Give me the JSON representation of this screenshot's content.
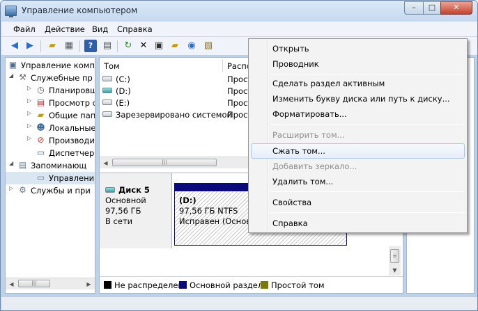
{
  "window": {
    "title": "Управление компьютером",
    "min_label": "–",
    "max_label": "□",
    "close_label": "✕"
  },
  "menu": [
    "Файл",
    "Действие",
    "Вид",
    "Справка"
  ],
  "toolbar_icons": [
    "back-icon",
    "forward-icon",
    "up-folder-icon",
    "show-hide-tree-icon",
    "help-icon",
    "show-action-pane-icon",
    "refresh-icon",
    "delete-icon",
    "properties-icon",
    "open-folder-icon",
    "search-icon",
    "wizard-icon"
  ],
  "tree": [
    {
      "label": "Управление компь",
      "icon": "computer-icon"
    },
    {
      "label": "Служебные пр",
      "icon": "tools-icon"
    },
    {
      "label": "Планировщ",
      "icon": "clock-icon"
    },
    {
      "label": "Просмотр с",
      "icon": "event-viewer-icon"
    },
    {
      "label": "Общие пап",
      "icon": "shared-folders-icon"
    },
    {
      "label": "Локальные",
      "icon": "users-icon"
    },
    {
      "label": "Производи",
      "icon": "performance-icon"
    },
    {
      "label": "Диспетчер",
      "icon": "device-manager-icon"
    },
    {
      "label": "Запоминающ",
      "icon": "storage-icon"
    },
    {
      "label": "Управлени",
      "icon": "disk-management-icon"
    },
    {
      "label": "Службы и при",
      "icon": "services-icon"
    }
  ],
  "volumes": {
    "columns": [
      "Том",
      "Распо"
    ],
    "rows": [
      {
        "name": "(C:)",
        "layout": "Прост"
      },
      {
        "name": "(D:)",
        "layout": "Прост"
      },
      {
        "name": "(E:)",
        "layout": "Прост"
      },
      {
        "name": "Зарезервировано системой",
        "layout": "Прост"
      }
    ]
  },
  "disk": {
    "name": "Диск 5",
    "type": "Основной",
    "size": "97,56 ГБ",
    "status": "В сети"
  },
  "partition": {
    "label": "(D:)",
    "size_fs": "97,56 ГБ NTFS",
    "status": "Исправен (Основн"
  },
  "legend": [
    {
      "label": "Не распределен",
      "color": "#000000"
    },
    {
      "label": "Основной раздел",
      "color": "#0a0a7a"
    },
    {
      "label": "Простой том",
      "color": "#7a7a0a"
    }
  ],
  "context_menu": {
    "items": [
      {
        "label": "Открыть",
        "disabled": false
      },
      {
        "label": "Проводник",
        "disabled": false
      },
      {
        "label": "Сделать раздел активным",
        "disabled": false
      },
      {
        "label": "Изменить букву диска или путь к диску...",
        "disabled": false
      },
      {
        "label": "Форматировать...",
        "disabled": false
      },
      {
        "label": "Расширить том...",
        "disabled": true
      },
      {
        "label": "Сжать том...",
        "disabled": false,
        "hover": true
      },
      {
        "label": "Добавить зеркало...",
        "disabled": true
      },
      {
        "label": "Удалить том...",
        "disabled": false
      },
      {
        "label": "Свойства",
        "disabled": false
      },
      {
        "label": "Справка",
        "disabled": false
      }
    ]
  }
}
